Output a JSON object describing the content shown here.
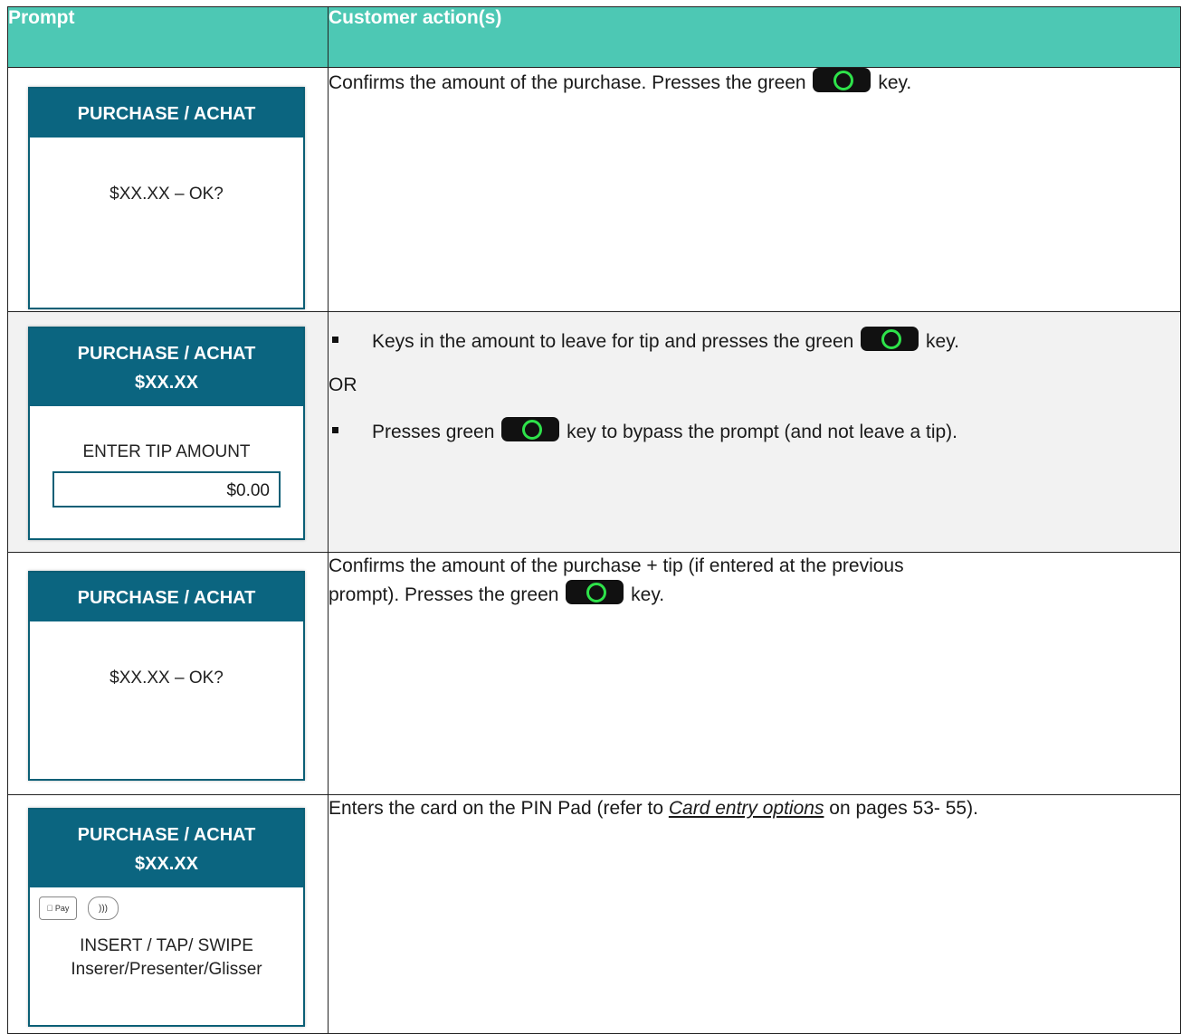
{
  "header": {
    "prompt": "Prompt",
    "action": "Customer action(s)"
  },
  "rows": [
    {
      "screen_title": "PURCHASE / ACHAT",
      "screen_body": "$XX.XX – OK?",
      "action_before": "Confirms the amount of the purchase. Presses the green",
      "action_after": "key."
    },
    {
      "screen_title": "PURCHASE / ACHAT",
      "screen_amount": "$XX.XX",
      "screen_label": "ENTER TIP AMOUNT",
      "screen_value": "$0.00",
      "bullet1_before": "Keys in the amount to leave for tip and presses the green",
      "bullet1_after": "key.",
      "or": "OR",
      "bullet2_before": "Presses green",
      "bullet2_after": "key to bypass the prompt (and not leave a tip)."
    },
    {
      "screen_title": "PURCHASE / ACHAT",
      "screen_body": "$XX.XX – OK?",
      "action_line1": "Confirms the amount of the purchase + tip (if entered at the previous",
      "action_before": "prompt). Presses the green",
      "action_after": "key."
    },
    {
      "screen_title": "PURCHASE / ACHAT",
      "screen_amount": "$XX.XX",
      "apple_pay": "Pay",
      "screen_line1": "INSERT / TAP/ SWIPE",
      "screen_line2": "Inserer/Presenter/Glisser",
      "action_before": "Enters the card on the PIN Pad (refer to ",
      "action_link": "Card entry options",
      "action_after": " on pages 53- 55)."
    }
  ],
  "icons": {
    "green_key": "green-ok-key-icon",
    "contactless": "contactless-icon",
    "apple_pay": "apple-pay-icon"
  },
  "colors": {
    "header_bg": "#4dc8b4",
    "screen_header": "#0b6580",
    "key_ring": "#2ee24a"
  }
}
